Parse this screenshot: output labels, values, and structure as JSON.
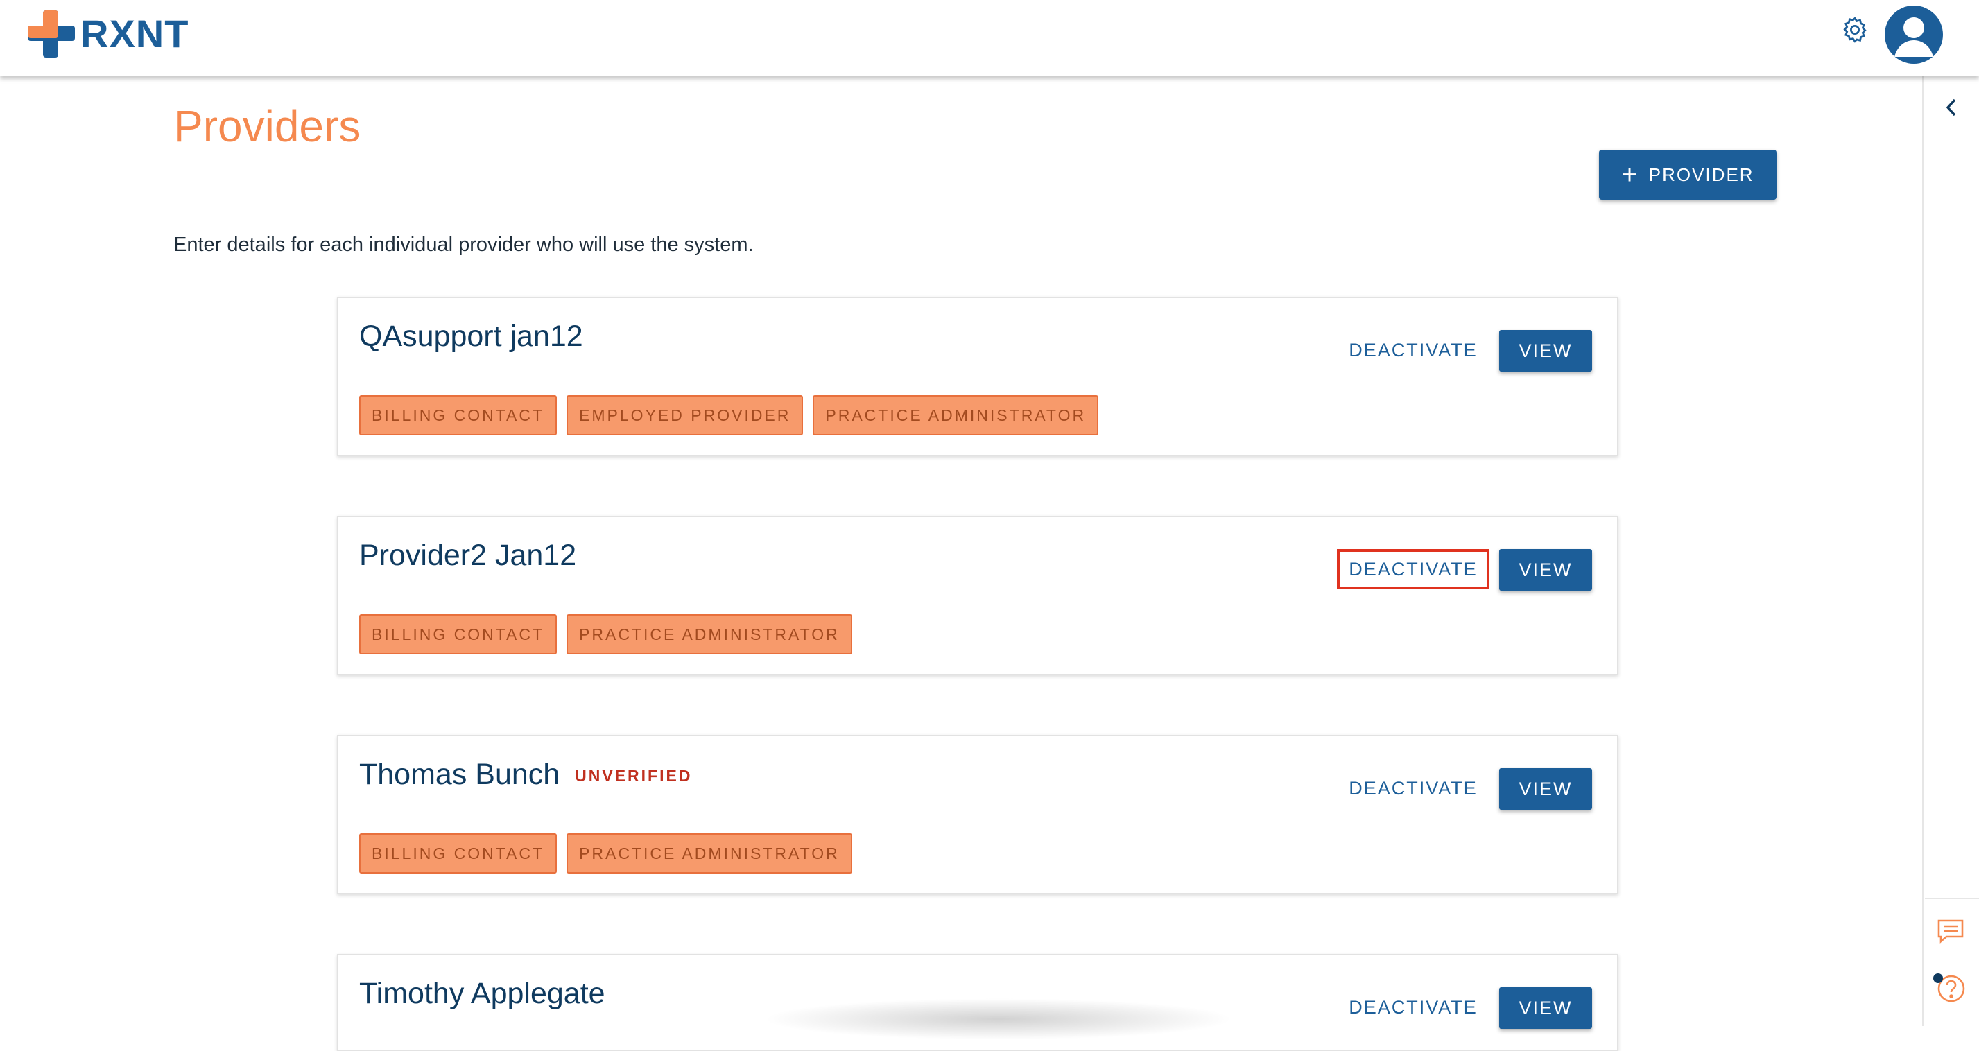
{
  "header": {
    "logo_text": "RXNT",
    "brand_blue": "#1c5e99",
    "brand_orange": "#f5894f"
  },
  "page": {
    "title": "Providers",
    "add_button_label": "PROVIDER",
    "subtitle": "Enter details for each individual provider who will use the system."
  },
  "providers": [
    {
      "name": "QAsupport jan12",
      "status": "",
      "tags": [
        "BILLING CONTACT",
        "EMPLOYED PROVIDER",
        "PRACTICE ADMINISTRATOR"
      ],
      "deactivate_label": "DEACTIVATE",
      "view_label": "VIEW"
    },
    {
      "name": "Provider2 Jan12",
      "status": "",
      "tags": [
        "BILLING CONTACT",
        "PRACTICE ADMINISTRATOR"
      ],
      "deactivate_label": "DEACTIVATE",
      "view_label": "VIEW"
    },
    {
      "name": "Thomas Bunch",
      "status": "UNVERIFIED",
      "tags": [
        "BILLING CONTACT",
        "PRACTICE ADMINISTRATOR"
      ],
      "deactivate_label": "DEACTIVATE",
      "view_label": "VIEW"
    },
    {
      "name": "Timothy Applegate",
      "status": "",
      "tags": [],
      "deactivate_label": "DEACTIVATE",
      "view_label": "VIEW"
    }
  ],
  "icons": {
    "settings": "gear-icon",
    "profile": "avatar",
    "collapse": "chevron-left-icon",
    "chat": "chat-icon",
    "help": "help-icon"
  }
}
